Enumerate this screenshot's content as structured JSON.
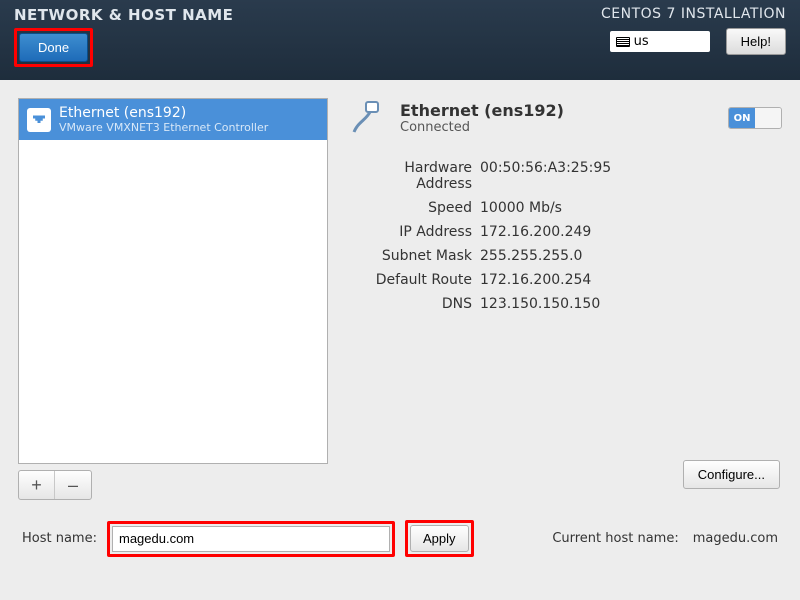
{
  "header": {
    "title": "NETWORK & HOST NAME",
    "done_label": "Done",
    "install_title": "CENTOS 7 INSTALLATION",
    "kb_layout": "us",
    "help_label": "Help!"
  },
  "nic": {
    "name": "Ethernet (ens192)",
    "subtitle": "VMware VMXNET3 Ethernet Controller"
  },
  "detail": {
    "name": "Ethernet (ens192)",
    "status": "Connected",
    "toggle_on": "ON",
    "rows": [
      {
        "label": "Hardware Address",
        "value": "00:50:56:A3:25:95"
      },
      {
        "label": "Speed",
        "value": "10000 Mb/s"
      },
      {
        "label": "IP Address",
        "value": "172.16.200.249"
      },
      {
        "label": "Subnet Mask",
        "value": "255.255.255.0"
      },
      {
        "label": "Default Route",
        "value": "172.16.200.254"
      },
      {
        "label": "DNS",
        "value": "123.150.150.150"
      }
    ],
    "configure_label": "Configure..."
  },
  "buttons": {
    "plus": "+",
    "minus": "–"
  },
  "host": {
    "label": "Host name:",
    "value": "magedu.com",
    "apply_label": "Apply",
    "current_label": "Current host name:",
    "current_value": "magedu.com"
  }
}
